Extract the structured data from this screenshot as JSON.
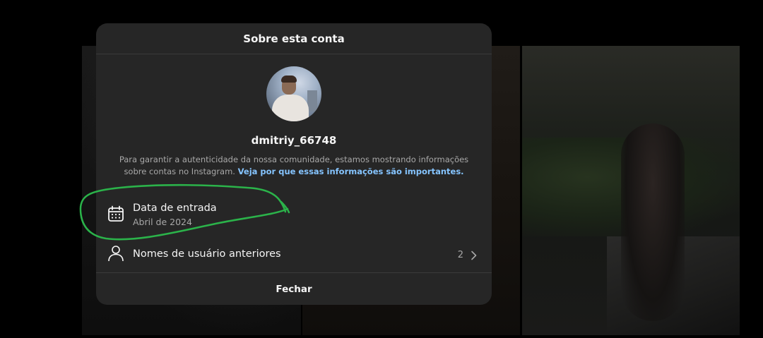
{
  "dialog": {
    "title": "Sobre esta conta",
    "username": "dmitriy_66748",
    "info_text": "Para garantir a autenticidade da nossa comunidade, estamos mostrando informações sobre contas no Instagram.",
    "info_link": "Veja por que essas informações são importantes.",
    "join_date": {
      "label": "Data de entrada",
      "value": "Abril de 2024",
      "icon": "calendar-icon"
    },
    "previous_usernames": {
      "label": "Nomes de usuário anteriores",
      "count": "2",
      "icon": "person-icon"
    },
    "close_label": "Fechar"
  },
  "annotation": {
    "shape": "hand-drawn ellipse",
    "color": "#2bb34a"
  }
}
